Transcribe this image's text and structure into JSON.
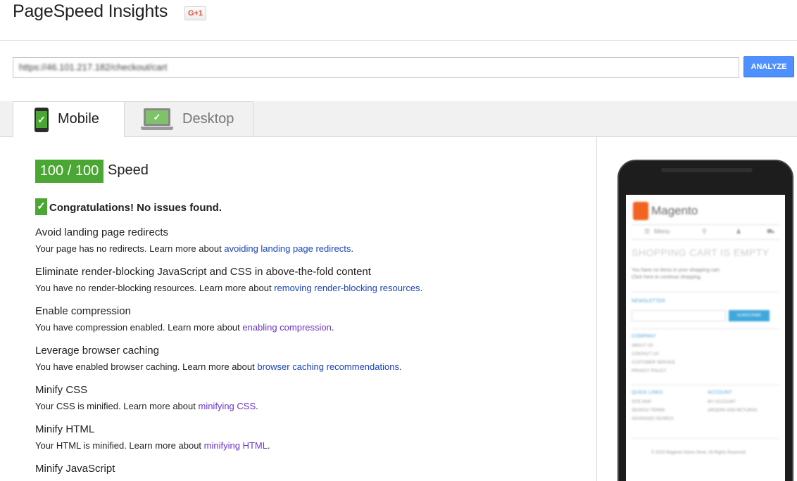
{
  "header": {
    "title": "PageSpeed Insights",
    "gplus_label": "G+1"
  },
  "search": {
    "url_value": "https://46.101.217.182/checkout/cart",
    "analyze_label": "ANALYZE"
  },
  "tabs": {
    "mobile_label": "Mobile",
    "desktop_label": "Desktop",
    "active": "Mobile"
  },
  "result": {
    "score": "100 / 100",
    "score_label": "Speed",
    "congrats": "Congratulations! No issues found.",
    "rules": [
      {
        "title": "Avoid landing page redirects",
        "desc": "Your page has no redirects. Learn more about ",
        "link": "avoiding landing page redirects",
        "suffix": "."
      },
      {
        "title": "Eliminate render-blocking JavaScript and CSS in above-the-fold content",
        "desc": "You have no render-blocking resources. Learn more about ",
        "link": "removing render-blocking resources",
        "suffix": "."
      },
      {
        "title": "Enable compression",
        "desc": "You have compression enabled. Learn more about ",
        "link": "enabling compression",
        "suffix": "."
      },
      {
        "title": "Leverage browser caching",
        "desc": "You have enabled browser caching. Learn more about ",
        "link": "browser caching recommendations",
        "suffix": "."
      },
      {
        "title": "Minify CSS",
        "desc": "Your CSS is minified. Learn more about ",
        "link": "minifying CSS",
        "suffix": "."
      },
      {
        "title": "Minify HTML",
        "desc": "Your HTML is minified. Learn more about ",
        "link": "minifying HTML",
        "suffix": "."
      },
      {
        "title": "Minify JavaScript"
      }
    ]
  },
  "preview": {
    "brand": "Magento",
    "nav_menu": "Menu",
    "heading": "SHOPPING CART IS EMPTY",
    "text_1": "You have no items in your shopping cart.",
    "text_2": "Click here to continue shopping.",
    "newsletter": "NEWSLETTER",
    "subscribe": "SUBSCRIBE",
    "company": "COMPANY",
    "company_links": [
      "ABOUT US",
      "CONTACT US",
      "CUSTOMER SERVICE",
      "PRIVACY POLICY"
    ],
    "quick_links": "QUICK LINKS",
    "quick_items": [
      "SITE MAP",
      "SEARCH TERMS",
      "ADVANCED SEARCH"
    ],
    "account": "ACCOUNT",
    "account_items": [
      "MY ACCOUNT",
      "ORDERS AND RETURNS"
    ],
    "footer": "© 2015 Magento Demo Store. All Rights Reserved."
  },
  "colors": {
    "score_green": "#4ba733",
    "analyze_blue": "#4d90fe",
    "link_blue": "#1a44b8",
    "link_visited": "#6b35c4"
  }
}
